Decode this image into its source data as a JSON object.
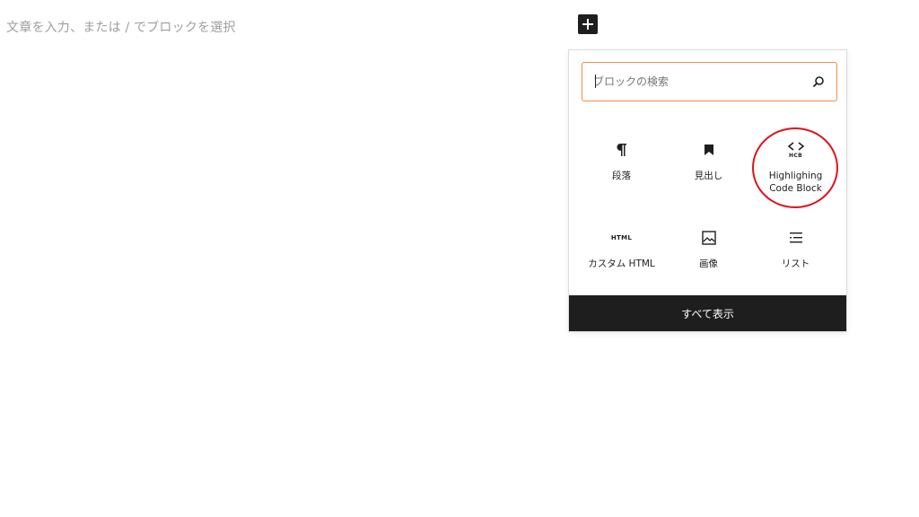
{
  "editor": {
    "placeholder": "文章を入力、または / でブロックを選択"
  },
  "inserter": {
    "search": {
      "placeholder": "ブロックの検索",
      "value": "",
      "icon": "search-icon"
    },
    "blocks": [
      {
        "label": "段落",
        "icon": "paragraph-icon"
      },
      {
        "label": "見出し",
        "icon": "bookmark-icon"
      },
      {
        "label": "Highlighing\nCode Block",
        "icon": "hcb-code-icon",
        "icon_text": "HCB",
        "highlighted": true
      },
      {
        "label": "カスタム HTML",
        "icon": "html-icon",
        "icon_text": "HTML"
      },
      {
        "label": "画像",
        "icon": "image-icon"
      },
      {
        "label": "リスト",
        "icon": "list-icon"
      }
    ],
    "show_all_label": "すべて表示"
  },
  "colors": {
    "accent_orange": "#f28a4e",
    "annotation_red": "#e3111a",
    "dark": "#1e1e1e"
  }
}
